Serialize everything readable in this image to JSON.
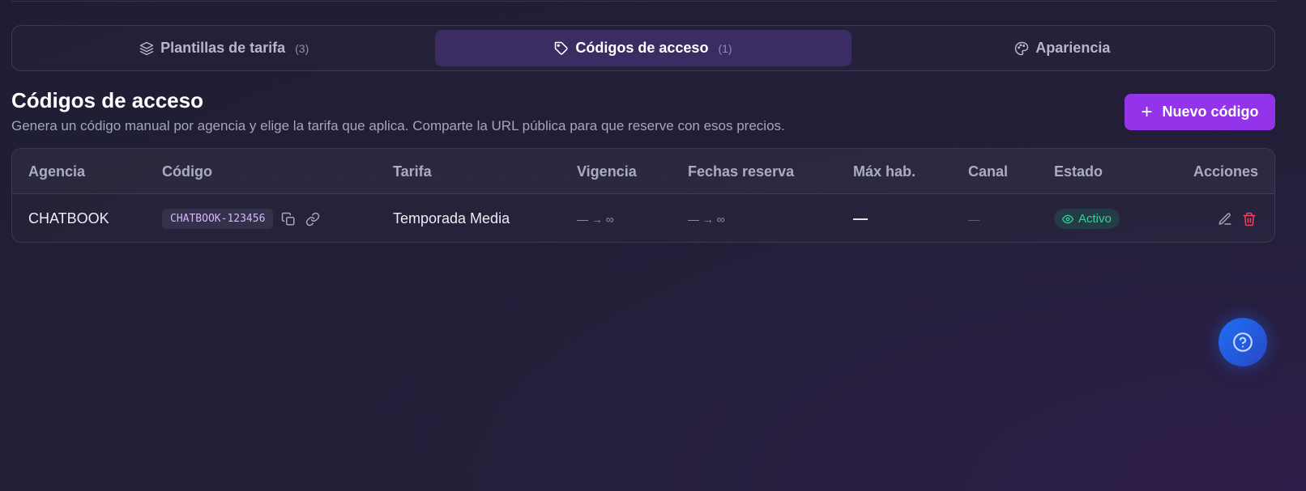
{
  "tabs": [
    {
      "label": "Plantillas de tarifa",
      "count": "(3)",
      "icon": "layers-icon"
    },
    {
      "label": "Códigos de acceso",
      "count": "(1)",
      "icon": "tag-icon"
    },
    {
      "label": "Apariencia",
      "count": "",
      "icon": "palette-icon"
    }
  ],
  "active_tab": 1,
  "section": {
    "title": "Códigos de acceso",
    "subtitle": "Genera un código manual por agencia y elige la tarifa que aplica. Comparte la URL pública para que reserve con esos precios.",
    "new_button_label": "Nuevo código"
  },
  "table": {
    "columns": [
      "Agencia",
      "Código",
      "Tarifa",
      "Vigencia",
      "Fechas reserva",
      "Máx hab.",
      "Canal",
      "Estado",
      "Acciones"
    ],
    "rows": [
      {
        "agencia": "CHATBOOK",
        "codigo": "CHATBOOK-123456",
        "tarifa": "Temporada Media",
        "vigencia": "— → ∞",
        "fechas_reserva": "— → ∞",
        "max_hab": "—",
        "canal": "—",
        "estado": "Activo"
      }
    ]
  },
  "colors": {
    "accent": "#9333ea",
    "active_tab_bg": "#3b2d63",
    "status_green": "#34d399",
    "delete_red": "#f43f5e",
    "help_blue": "#1e6ff5"
  }
}
